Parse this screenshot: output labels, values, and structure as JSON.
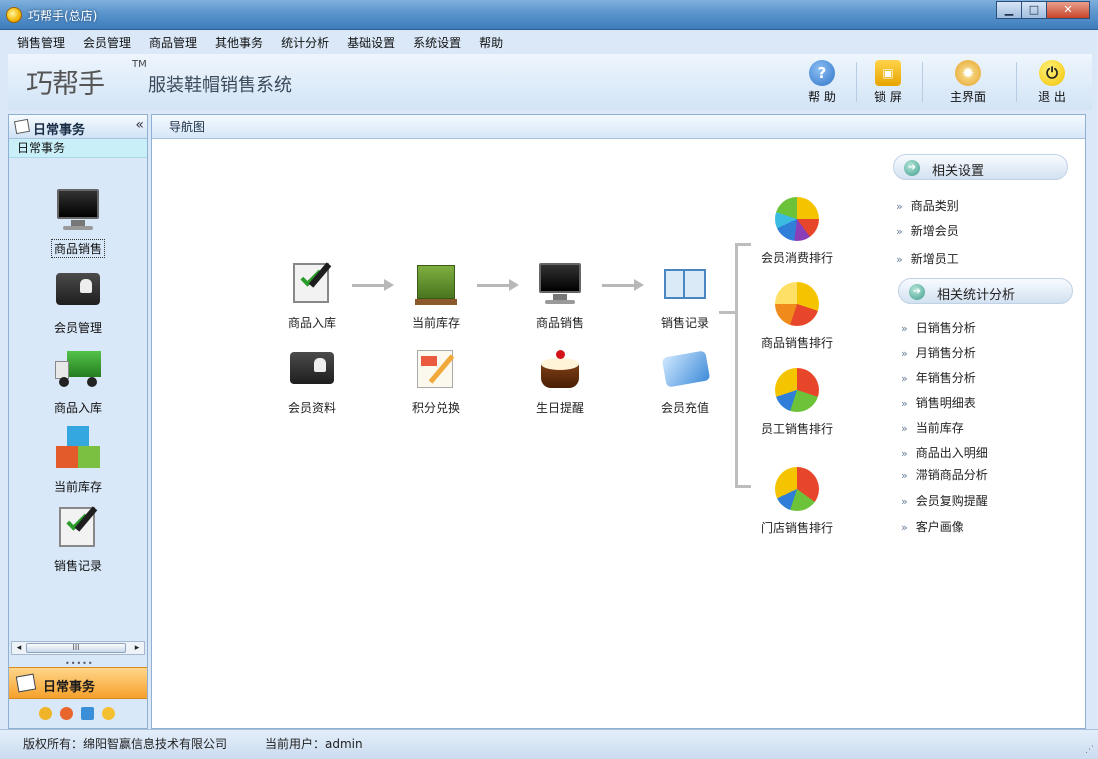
{
  "window": {
    "title": "巧帮手(总店)",
    "minimize": "▁",
    "maximize": "□",
    "close": "✕"
  },
  "menu": [
    "销售管理",
    "会员管理",
    "商品管理",
    "其他事务",
    "统计分析",
    "基础设置",
    "系统设置",
    "帮助"
  ],
  "header": {
    "brand": "巧帮手",
    "tm": "TM",
    "subtitle": "服装鞋帽销售系统",
    "tools": [
      {
        "label": "帮 助",
        "icon": "help-icon",
        "color": "#2f73c7",
        "glyph": "?"
      },
      {
        "label": "锁 屏",
        "icon": "lock-icon",
        "color": "#e7a400",
        "glyph": "▣"
      },
      {
        "label": "主界面",
        "icon": "gear-icon",
        "color": "#e4a227",
        "glyph": "✹"
      },
      {
        "label": "退 出",
        "icon": "power-icon",
        "color": "#f2c200",
        "glyph": "⏻"
      }
    ]
  },
  "left_panel": {
    "title": "日常事务",
    "collapse": "«",
    "subtitle": "日常事务",
    "items": [
      {
        "label": "商品销售",
        "icon": "monitor-icon"
      },
      {
        "label": "会员管理",
        "icon": "member-card-icon"
      },
      {
        "label": "商品入库",
        "icon": "truck-icon"
      },
      {
        "label": "当前库存",
        "icon": "cubes-icon"
      },
      {
        "label": "销售记录",
        "icon": "clipboard-check-icon"
      }
    ],
    "scroll_arrow_left": "◂",
    "scroll_arrow_right": "▸",
    "scroll_thumb": "III",
    "grip": "•••••",
    "active_group": "日常事务"
  },
  "content": {
    "tab": "导航图",
    "flow": [
      {
        "label": "商品入库",
        "icon": "clipboard-check-icon"
      },
      {
        "label": "当前库存",
        "icon": "crates-icon"
      },
      {
        "label": "商品销售",
        "icon": "monitor-icon"
      },
      {
        "label": "销售记录",
        "icon": "book-icon"
      }
    ],
    "row2": [
      {
        "label": "会员资料",
        "icon": "member-card-icon"
      },
      {
        "label": "积分兑换",
        "icon": "paper-pencil-icon"
      },
      {
        "label": "生日提醒",
        "icon": "cake-icon"
      },
      {
        "label": "会员充值",
        "icon": "vip-card-icon"
      }
    ],
    "rankings": [
      {
        "label": "会员消费排行",
        "icon": "pie-chart-icon"
      },
      {
        "label": "商品销售排行",
        "icon": "pie-chart-icon"
      },
      {
        "label": "员工销售排行",
        "icon": "pie-chart-icon"
      },
      {
        "label": "门店销售排行",
        "icon": "pie-chart-icon"
      }
    ],
    "settings": {
      "title": "相关设置",
      "links": [
        "商品类别",
        "新增会员",
        "新增员工"
      ]
    },
    "stats": {
      "title": "相关统计分析",
      "links": [
        "日销售分析",
        "月销售分析",
        "年销售分析",
        "销售明细表",
        "当前库存",
        "商品出入明细",
        "滞销商品分析",
        "会员复购提醒",
        "客户画像"
      ]
    },
    "chevron": "»",
    "go_glyph": "➜"
  },
  "status": {
    "copyright": "版权所有：绵阳智赢信息技术有限公司",
    "user": "当前用户：admin",
    "grip": "⋰"
  }
}
